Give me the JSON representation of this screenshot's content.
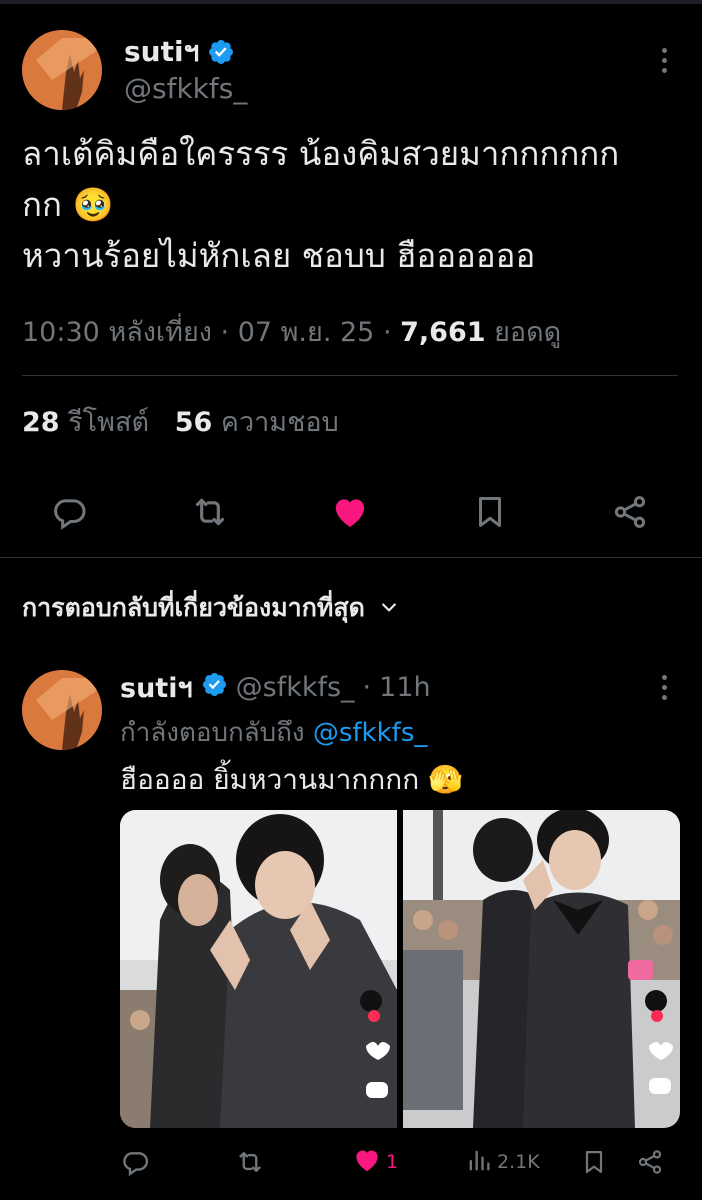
{
  "colors": {
    "background": "#000000",
    "text_primary": "#e7e9ea",
    "text_secondary": "#71767b",
    "accent_blue": "#1d9bf0",
    "like_pink": "#f91880",
    "divider": "#2f3336"
  },
  "tweet": {
    "author_name": "sutiฯ",
    "author_handle": "@sfkkfs_",
    "verified_icon": "verified-badge-icon",
    "text_line1": "ลาเต้คิมคือใครรรร น้องคิมสวยมากกกกกก",
    "text_line2": "กก 🥹",
    "text_line3": "หวานร้อยไม่หักเลย ชอบบ ฮืออออออ",
    "time": "10:30 หลังเที่ยง · 07 พ.ย. 25 · ",
    "views_count": "7,661",
    "views_label": " ยอดดู",
    "reposts_count": "28",
    "reposts_label": " รีโพสต์",
    "likes_count": "56",
    "likes_label": " ความชอบ",
    "liked": true
  },
  "actions": {
    "reply_icon": "reply-icon",
    "repost_icon": "repost-icon",
    "like_icon": "heart-filled-icon",
    "bookmark_icon": "bookmark-icon",
    "share_icon": "share-icon"
  },
  "replies_header": {
    "label": "การตอบกลับที่เกี่ยวข้องมากที่สุด",
    "icon": "chevron-down-icon"
  },
  "reply": {
    "author_name": "sutiฯ",
    "author_handle": "@sfkkfs_",
    "time_sep": "·",
    "time": "11h",
    "replying_to_label": "กำลังตอบกลับถึง ",
    "replying_to_handle": "@sfkkfs_",
    "text": "ฮืออออ ยิ้มหวานมากกกก 🫣",
    "likes": "1",
    "views": "2.1K",
    "media_count": 2
  }
}
